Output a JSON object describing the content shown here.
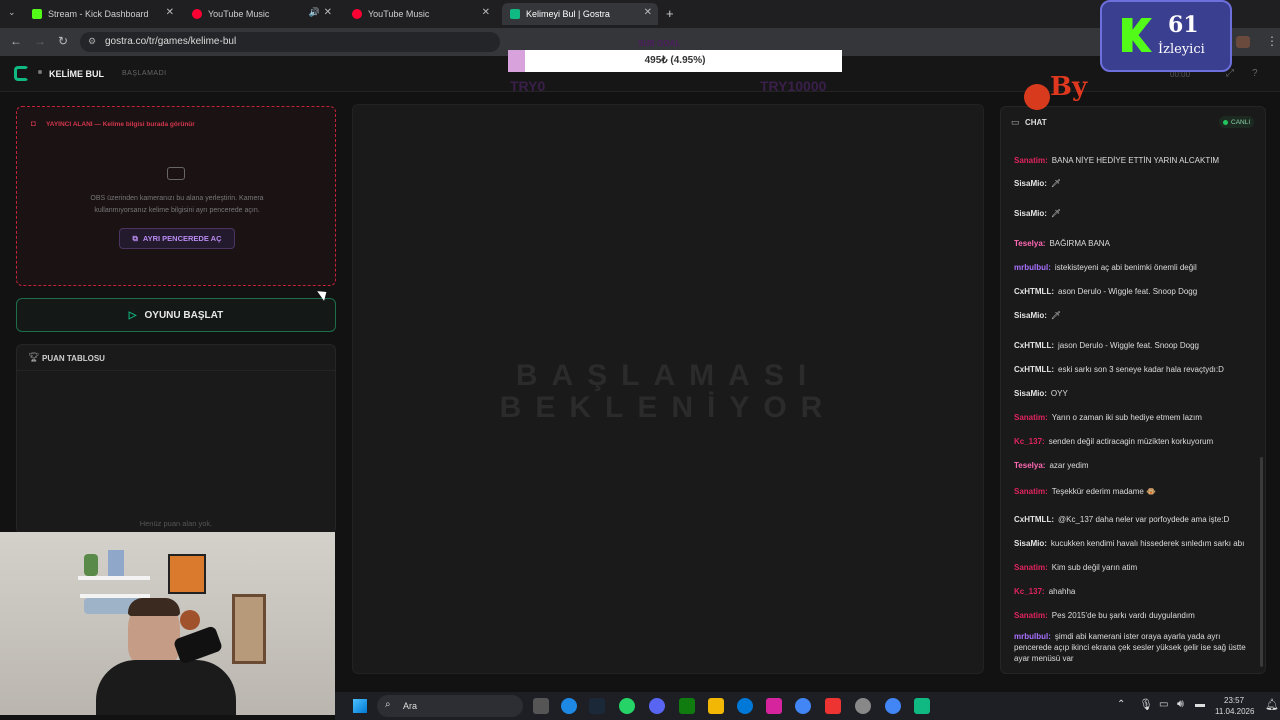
{
  "browser": {
    "tabs": [
      {
        "title": "Stream - Kick Dashboard",
        "color": "#53fc18"
      },
      {
        "title": "YouTube Music",
        "color": "#ff0033"
      },
      {
        "title": "YouTube Music",
        "color": "#ff0033"
      },
      {
        "title": "Kelimeyi Bul | Gostra",
        "color": "#10b981"
      }
    ],
    "url": "gostra.co/tr/games/kelime-bul"
  },
  "app": {
    "title": "KELİME BUL",
    "status": "BAŞLAMADI",
    "timer": "00:00"
  },
  "camera_zone": {
    "header": "YAYINCI ALANI — Kelime bilgisi burada görünür",
    "desc_line1": "OBS üzerinden kameranızı bu alana yerleştirin. Kamera",
    "desc_line2": "kullanmıyorsanız kelime bilgisini ayrı pencerede açın.",
    "open_window_label": "AYRI PENCEREDE AÇ"
  },
  "start_button_label": "OYUNU BAŞLAT",
  "scoreboard": {
    "title": "PUAN TABLOSU",
    "empty": "Henüz puan alan yok."
  },
  "center": {
    "line1": "BAŞLAMASI",
    "line2": "BEKLENİYOR"
  },
  "chat": {
    "title": "CHAT",
    "live": "CANLI",
    "messages": [
      {
        "user": "Sanatim:",
        "color": "#e0245e",
        "text": "BANA NİYE HEDİYE ETTİN YARIN ALCAKTIM"
      },
      {
        "user": "SisaMio:",
        "color": "#e5e5e5",
        "text": "🗡"
      },
      {
        "user": "SisaMio:",
        "color": "#e5e5e5",
        "text": "🗡"
      },
      {
        "user": "Teselya:",
        "color": "#ff69b4",
        "text": "BAĞIRMA BANA"
      },
      {
        "user": "mrbulbul:",
        "color": "#a970ff",
        "text": "istekisteyeni aç abi benimki önemli değil"
      },
      {
        "user": "CxHTMLL:",
        "color": "#e5e5e5",
        "text": "ason Derulo - Wiggle feat. Snoop Dogg"
      },
      {
        "user": "SisaMio:",
        "color": "#e5e5e5",
        "text": "🗡"
      },
      {
        "user": "CxHTMLL:",
        "color": "#e5e5e5",
        "text": "jason Derulo - Wiggle feat. Snoop Dogg"
      },
      {
        "user": "CxHTMLL:",
        "color": "#e5e5e5",
        "text": "eski sarkı son 3 seneye kadar hala revaçtydı:D"
      },
      {
        "user": "SisaMio:",
        "color": "#e5e5e5",
        "text": "OYY"
      },
      {
        "user": "Sanatim:",
        "color": "#e0245e",
        "text": "Yarın o zaman iki sub hediye etmem lazım"
      },
      {
        "user": "Kc_137:",
        "color": "#e0245e",
        "text": "senden değil actiracagin müzikten korkuyorum"
      },
      {
        "user": "Teselya:",
        "color": "#ff69b4",
        "text": "azar yedim"
      },
      {
        "user": "Sanatim:",
        "color": "#e0245e",
        "text": "Teşekkür ederim madame 🐵"
      },
      {
        "user": "CxHTMLL:",
        "color": "#e5e5e5",
        "text": "@Kc_137 daha neler var porfoydede ama işte:D"
      },
      {
        "user": "SisaMio:",
        "color": "#e5e5e5",
        "text": "kucukken kendimi havalı hissederek sınledım sarkı abı"
      },
      {
        "user": "Sanatim:",
        "color": "#e0245e",
        "text": "Kim sub değil yarın atim"
      },
      {
        "user": "Kc_137:",
        "color": "#e0245e",
        "text": "ahahha"
      },
      {
        "user": "Sanatim:",
        "color": "#e0245e",
        "text": "Pes 2015'de bu şarkı vardı duygulandım"
      },
      {
        "user": "mrbulbul:",
        "color": "#a970ff",
        "text": "şimdi abi kamerani ister oraya ayarla yada ayrı pencerede açıp ikinci ekrana çek sesler yüksek gelir ise sağ üstte ayar menüsü var"
      }
    ]
  },
  "overlay": {
    "progress_text": "495₺ (4.95%)",
    "progress_fraction": 0.0495,
    "goal_label": "SUB GOAL",
    "left_amount": "TRY0",
    "right_amount": "TRY10000"
  },
  "kick_widget": {
    "count": "61",
    "label": "İzleyici"
  },
  "watermark": "By",
  "taskbar": {
    "search_placeholder": "Ara",
    "time": "23:57",
    "date": "11.04.2026"
  }
}
